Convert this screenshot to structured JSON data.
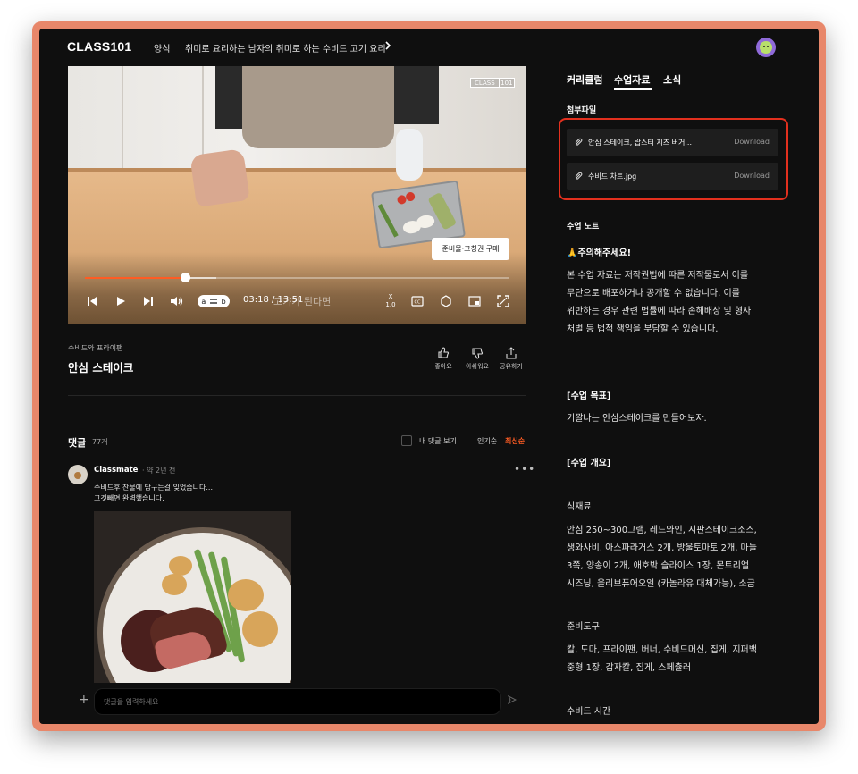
{
  "header": {
    "logo": "CLASS101",
    "breadcrumb_category": "양식",
    "breadcrumb_class": "취미로 요리하는 남자의 취미로 하는 수비드 고기 요리"
  },
  "video": {
    "watermark_left": "CLASS",
    "watermark_right": "101",
    "purchase_button": "준비물·코칭권 구매",
    "progress_played": 0.235,
    "progress_buffered": 0.31,
    "loop_a": "a",
    "loop_b": "b",
    "time": "03:18 / 13:51",
    "subtitle": "고기가 된다면",
    "speed_top": "X",
    "speed_bottom": "1.0",
    "cc_label": "CC"
  },
  "lesson": {
    "category": "수비드와 프라이팬",
    "title": "안심 스테이크",
    "like_label": "좋아요",
    "dislike_label": "아쉬워요",
    "share_label": "공유하기"
  },
  "comments": {
    "title": "댓글",
    "count": "77개",
    "mine_label": "내 댓글 보기",
    "sort_popular": "인기순",
    "sort_newest": "최신순",
    "items": [
      {
        "user": "Classmate",
        "time": "· 약 2년 전",
        "line1": "수비드후 찬물에 담구는걸 잊었습니다...",
        "line2": "그것빼면 완벽했습니다."
      }
    ],
    "input_placeholder": "댓글을 입력하세요"
  },
  "panel": {
    "tabs": [
      "커리큘럼",
      "수업자료",
      "소식"
    ],
    "active_tab": "수업자료",
    "attachments_title": "첨부파일",
    "files": [
      {
        "name": "안심 스테이크, 랍스터 치즈 버거...",
        "action": "Download"
      },
      {
        "name": "수비드 차트.jpg",
        "action": "Download"
      }
    ],
    "note_title": "수업 노트",
    "warning_title": "주의해주세요!",
    "warning_lines": [
      "본 수업 자료는 저작권법에 따른 저작물로서 이를",
      "무단으로 배포하거나 공개할 수 없습니다. 이를",
      "위반하는 경우 관련 법률에 따라 손해배상 및 형사",
      "처벌 등 법적 책임을 부담할 수 있습니다."
    ],
    "goal_header": "[수업 목표]",
    "goal_text": "기깔나는 안심스테이크를 만들어보자.",
    "overview_header": "[수업 개요]",
    "ingredients_title": "식재료",
    "ingredients_lines": [
      "안심 250~300그램, 레드와인, 시판스테이크소스,",
      "생와사비, 아스파라거스 2개, 방울토마토 2개, 마늘",
      "3쪽, 양송이 2개, 애호박 슬라이스 1장, 몬트리얼",
      "시즈닝, 올리브퓨어오일 (카놀라유 대체가능), 소금"
    ],
    "tools_title": "준비도구",
    "tools_lines": [
      "칼, 도마, 프라이팬, 버너, 수비드머신, 집게, 지퍼백",
      "중형 1장, 감자칼, 집게, 스페츌러"
    ],
    "sousvide_time_title": "수비드 시간"
  },
  "colors": {
    "accent": "#ff5c23",
    "highlight_box": "#e3301e",
    "frame": "#e8876a",
    "background": "#0f0f0f"
  },
  "icons": [
    "chevron-right-icon",
    "avatar-icon",
    "skip-back-icon",
    "play-icon",
    "skip-forward-icon",
    "volume-icon",
    "loop-icon",
    "cc-icon",
    "settings-icon",
    "pip-icon",
    "fullscreen-icon",
    "thumbs-up-icon",
    "thumbs-down-icon",
    "share-icon",
    "paperclip-icon",
    "plus-icon",
    "send-icon",
    "more-icon",
    "warning-emoji-icon"
  ]
}
